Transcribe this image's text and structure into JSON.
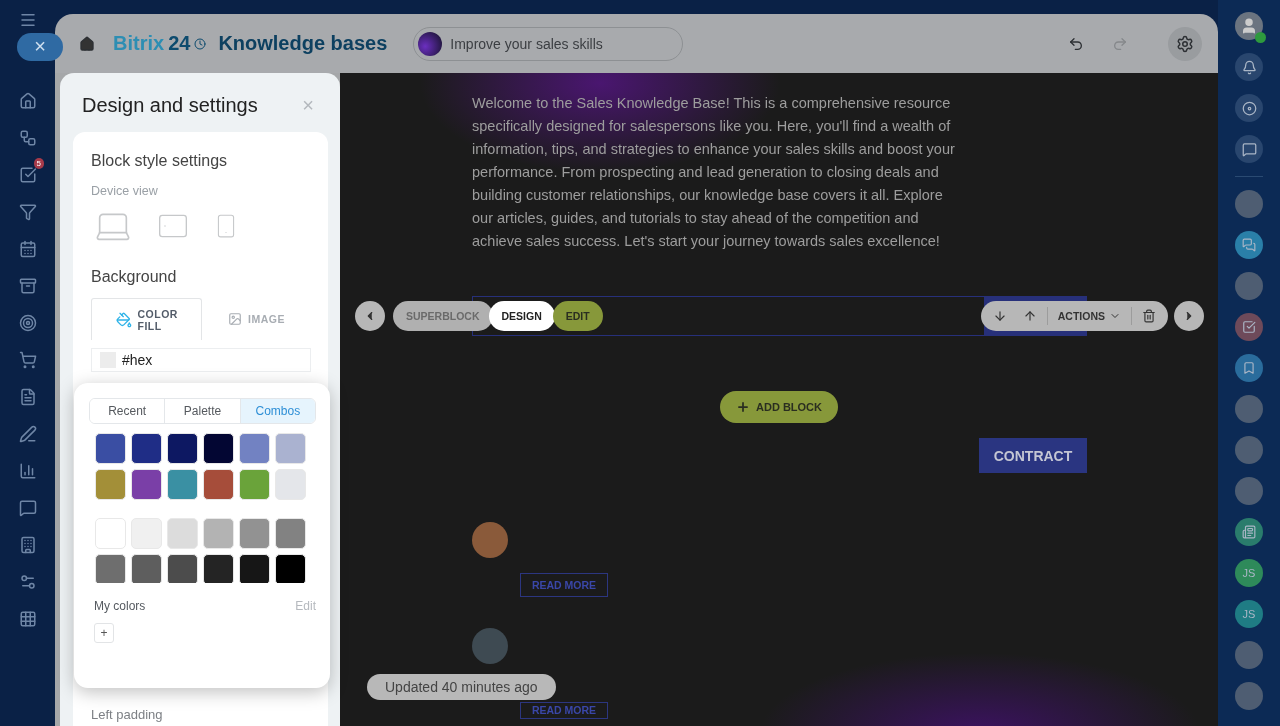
{
  "left_nav": {
    "close_label": "×",
    "tasks_badge": "5"
  },
  "header": {
    "brand_main": "Bitrix",
    "brand_num": "24",
    "title": "Knowledge bases",
    "kb_selector": "Improve your sales skills"
  },
  "panel": {
    "title": "Design and settings",
    "close_label": "×",
    "section": "Block style settings",
    "device_label": "Device view",
    "background_label": "Background",
    "bg_tabs": [
      {
        "label": "COLOR FILL",
        "kind": "fill",
        "selected": true
      },
      {
        "label": "IMAGE",
        "kind": "image",
        "selected": false
      }
    ],
    "hex_value": "#hex",
    "next_label": "Left padding"
  },
  "palette": {
    "tabs": [
      {
        "label": "Recent",
        "selected": false
      },
      {
        "label": "Palette",
        "selected": false
      },
      {
        "label": "Combos",
        "selected": true
      }
    ],
    "swatches": [
      {
        "color": "#3a4ea3"
      },
      {
        "color": "#1f2d86"
      },
      {
        "color": "#0d1862"
      },
      {
        "color": "#030633"
      },
      {
        "color": "#7282c2"
      },
      {
        "color": "#aab2d0"
      },
      {
        "color": "#a38f38"
      },
      {
        "color": "#7a3fa7"
      },
      {
        "color": "#3a90a3"
      },
      {
        "color": "#a64d3a"
      },
      {
        "color": "#6aa33a"
      },
      {
        "color": "#e4e6ea"
      }
    ],
    "grays": [
      {
        "color": "#ffffff"
      },
      {
        "color": "#f0f0f0"
      },
      {
        "color": "#dcdcdc"
      },
      {
        "color": "#b3b3b3"
      },
      {
        "color": "#929292"
      },
      {
        "color": "#828282"
      },
      {
        "color": "#6e6e6e"
      },
      {
        "color": "#5e5e5e"
      },
      {
        "color": "#4c4c4c"
      },
      {
        "color": "#242424"
      },
      {
        "color": "#161616"
      },
      {
        "color": "#000000"
      }
    ],
    "my_colors_label": "My colors",
    "edit_label": "Edit",
    "add_label": "+"
  },
  "content": {
    "intro": "Welcome to the Sales Knowledge Base! This is a comprehensive resource specifically designed for salespersons like you. Here, you'll find a wealth of information, tips, and strategies to enhance your sales skills and boost your performance. From prospecting and lead generation to closing deals and building customer relationships, our knowledge base covers it all. Explore our articles, guides, and tutorials to stay ahead of the competition and achieve sales success. Let's start your journey towards sales excellence!",
    "add_block": "ADD BLOCK",
    "contract_button": "CONTRACT",
    "posts": [
      {
        "read_more": "READ MORE"
      },
      {
        "read_more": "READ MORE"
      }
    ]
  },
  "toolbar": {
    "superblock": "SUPERBLOCK",
    "design": "DESIGN",
    "edit": "EDIT",
    "actions": "ACTIONS"
  },
  "updated": "Updated 40 minutes ago",
  "right_bar": {
    "items": [
      {
        "kind": "avatar"
      },
      {
        "kind": "chat"
      },
      {
        "kind": "avatar"
      },
      {
        "kind": "task"
      },
      {
        "kind": "bookmark"
      },
      {
        "kind": "avatar"
      },
      {
        "kind": "avatar"
      },
      {
        "kind": "avatar"
      },
      {
        "kind": "news"
      },
      {
        "kind": "initials",
        "label": "JS",
        "color": "#2e8a5a"
      },
      {
        "kind": "initials",
        "label": "JS",
        "color": "#1f7c84"
      },
      {
        "kind": "avatar"
      },
      {
        "kind": "avatar"
      }
    ]
  }
}
